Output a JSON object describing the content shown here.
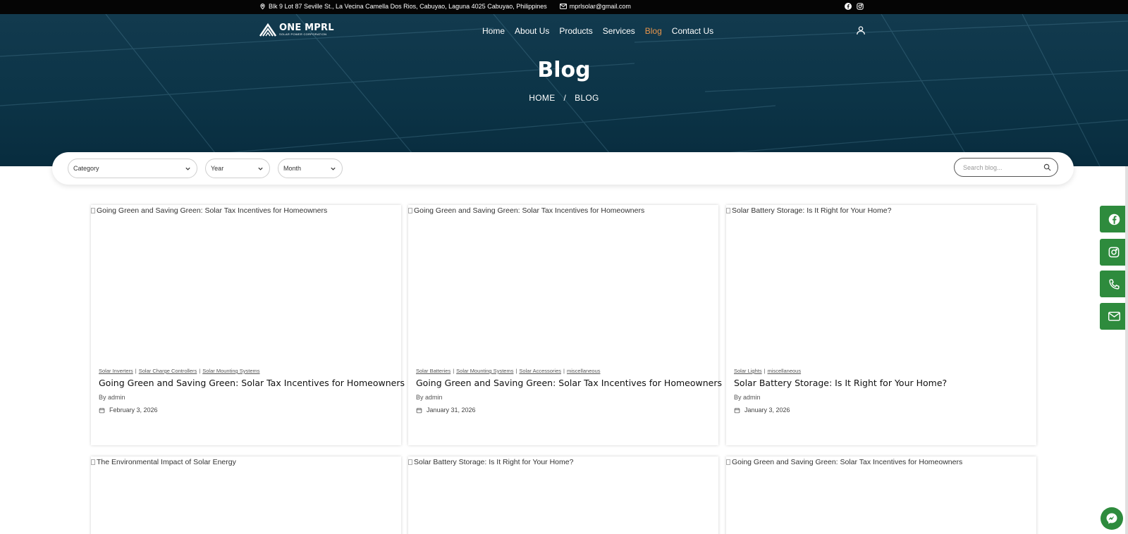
{
  "topbar": {
    "address": "Blk 9 Lot 87 Seville St., La Vecina Camella Dos Rios, Cabuyao, Laguna 4025 Cabuyao, Philippines",
    "email": "mprlsolar@gmail.com"
  },
  "logo": {
    "name": "ONE MPRL",
    "subtitle": "SOLAR POWER CORPORATION"
  },
  "nav": {
    "home": "Home",
    "about": "About Us",
    "products": "Products",
    "services": "Services",
    "blog": "Blog",
    "contact": "Contact Us"
  },
  "hero": {
    "title": "Blog",
    "crumb_home": "HOME",
    "crumb_sep": "/",
    "crumb_current": "BLOG"
  },
  "filters": {
    "category": "Category",
    "year": "Year",
    "month": "Month",
    "search_placeholder": "Search blog..."
  },
  "posts": [
    {
      "img_alt": "Going Green and Saving Green: Solar Tax Incentives for Homeowners",
      "categories": [
        "Solar Inverters",
        "Solar Charge Controllers",
        "Solar Mounting Systems"
      ],
      "title": "Going Green and Saving Green: Solar Tax Incentives for Homeowners",
      "author": "By admin",
      "date": "February 3, 2026"
    },
    {
      "img_alt": "Going Green and Saving Green: Solar Tax Incentives for Homeowners",
      "categories": [
        "Solar Batteries",
        "Solar Mounting Systems",
        "Solar Accessories",
        "miscellaneous"
      ],
      "title": "Going Green and Saving Green: Solar Tax Incentives for Homeowners",
      "author": "By admin",
      "date": "January 31, 2026"
    },
    {
      "img_alt": "Solar Battery Storage: Is It Right for Your Home?",
      "categories": [
        "Solar Lights",
        "miscellaneous"
      ],
      "title": "Solar Battery Storage: Is It Right for Your Home?",
      "author": "By admin",
      "date": "January 3, 2026"
    },
    {
      "img_alt": "The Environmental Impact of Solar Energy"
    },
    {
      "img_alt": "Solar Battery Storage: Is It Right for Your Home?"
    },
    {
      "img_alt": "Going Green and Saving Green: Solar Tax Incentives for Homeowners"
    }
  ],
  "colors": {
    "hero": "#0c3447",
    "accent": "#e7954b",
    "social_green": "#2e8b3d"
  }
}
